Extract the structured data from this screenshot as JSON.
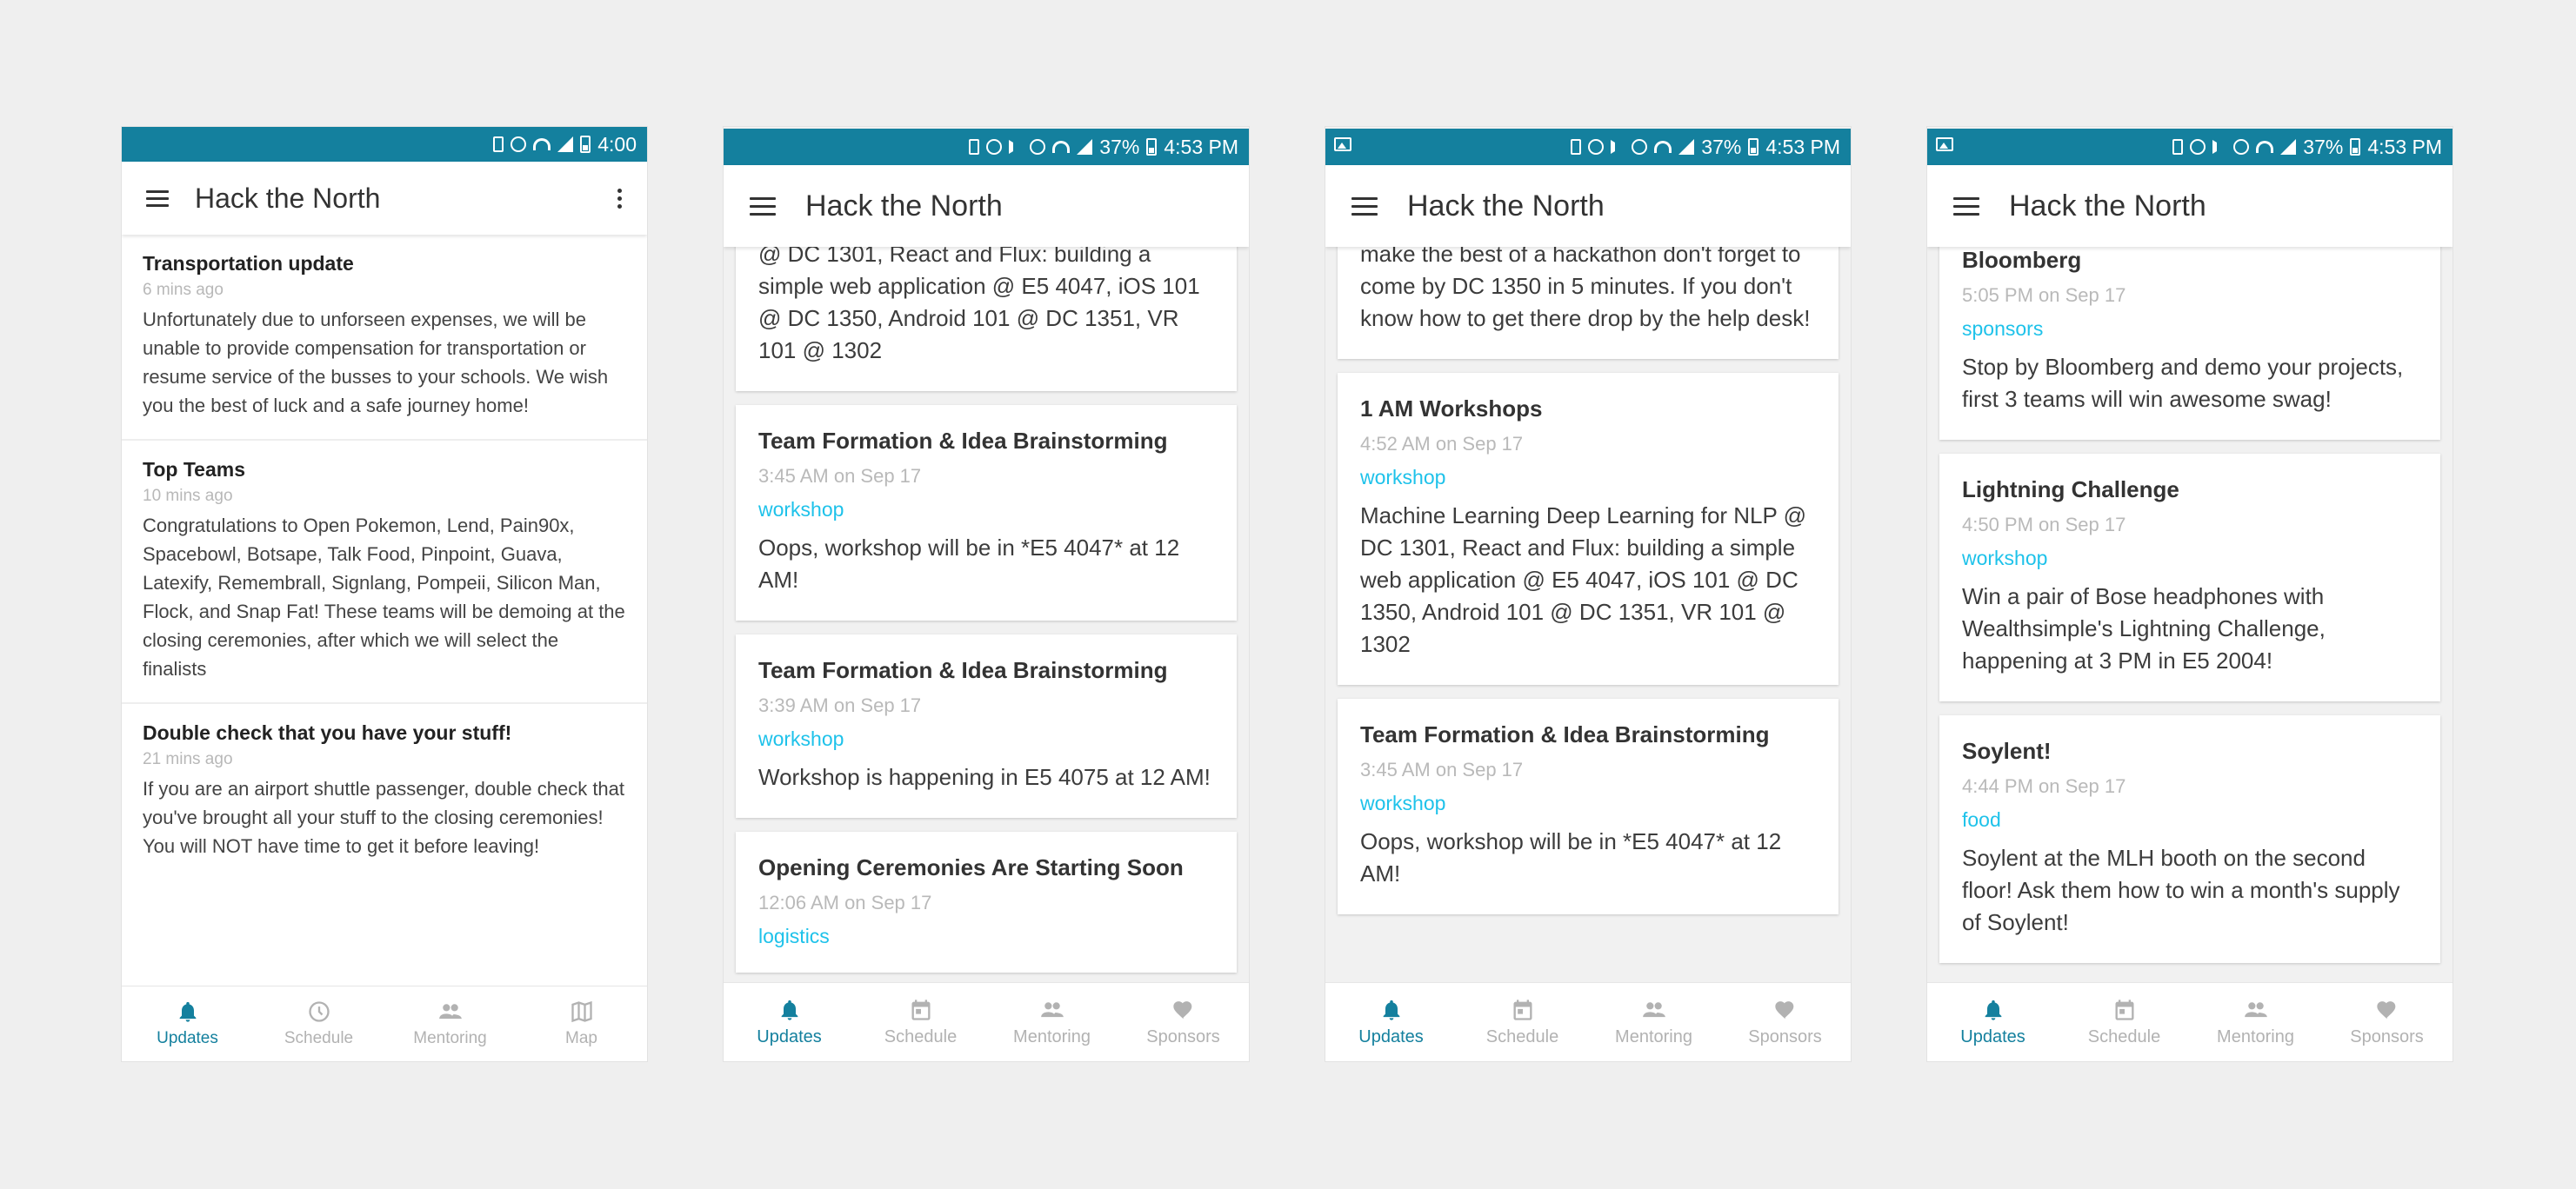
{
  "colors": {
    "statusbar": "#14809e",
    "accent": "#14809e",
    "tag": "#1ec2ea",
    "inactive": "#b2b2b2",
    "background": "#efefef"
  },
  "app_title": "Hack the North",
  "screens": [
    {
      "status": {
        "time": "4:00",
        "battery": "",
        "icons": [
          "vibrate-icon",
          "alarm-icon",
          "wifi-icon",
          "signal-icon",
          "battery-icon"
        ]
      },
      "updates": [
        {
          "title": "Transportation update",
          "time": "6 mins ago",
          "body": "Unfortunately due to unforseen expenses, we will be unable to provide compensation for transportation or resume service of the busses to your schools. We wish you the best of luck and a safe journey home!"
        },
        {
          "title": "Top Teams",
          "time": "10 mins ago",
          "body": "Congratulations to Open Pokemon, Lend, Pain90x, Spacebowl, Botsape, Talk Food, Pinpoint, Guava, Latexify, Remembrall, Signlang, Pompeii, Silicon Man, Flock, and Snap Fat! These teams will be demoing at the closing ceremonies, after which we will select the finalists"
        },
        {
          "title": "Double check that you have your stuff!",
          "time": "21 mins ago",
          "body": "If you are an airport shuttle passenger, double check that you've brought all your stuff to the closing ceremonies! You will NOT have time to get it before leaving!"
        }
      ],
      "nav": [
        {
          "label": "Updates",
          "icon": "bell-icon",
          "active": true
        },
        {
          "label": "Schedule",
          "icon": "clock-icon",
          "active": false
        },
        {
          "label": "Mentoring",
          "icon": "people-icon",
          "active": false
        },
        {
          "label": "Map",
          "icon": "map-icon",
          "active": false
        }
      ]
    },
    {
      "status": {
        "time": "4:53 PM",
        "battery": "37%"
      },
      "cards": [
        {
          "title": "",
          "time": "",
          "tag": "",
          "body": "@ DC 1301, React and Flux: building a simple web application @ E5 4047, iOS 101 @ DC 1350, Android 101 @ DC 1351, VR 101 @ 1302"
        },
        {
          "title": "Team Formation & Idea Brainstorming",
          "time": "3:45 AM on Sep 17",
          "tag": "workshop",
          "body": "Oops, workshop will be in *E5 4047* at 12 AM!"
        },
        {
          "title": "Team Formation & Idea Brainstorming",
          "time": "3:39 AM on Sep 17",
          "tag": "workshop",
          "body": "Workshop is happening in E5 4075 at 12 AM!"
        },
        {
          "title": "Opening Ceremonies Are Starting Soon",
          "time": "12:06 AM on Sep 17",
          "tag": "logistics",
          "body": ""
        }
      ],
      "nav": [
        {
          "label": "Updates",
          "active": true
        },
        {
          "label": "Schedule",
          "active": false
        },
        {
          "label": "Mentoring",
          "active": false
        },
        {
          "label": "Sponsors",
          "active": false
        }
      ]
    },
    {
      "status": {
        "time": "4:53 PM",
        "battery": "37%"
      },
      "cards": [
        {
          "title": "",
          "time": "",
          "tag": "",
          "body": "make the best of a hackathon don't forget to come by DC 1350 in 5 minutes. If you don't know how to get there drop by the help desk!"
        },
        {
          "title": "1 AM Workshops",
          "time": "4:52 AM on Sep 17",
          "tag": "workshop",
          "body": "Machine Learning Deep Learning for NLP @ DC 1301, React and Flux: building a simple web application @ E5 4047, iOS 101 @ DC 1350, Android 101 @ DC 1351, VR 101 @ 1302"
        },
        {
          "title": "Team Formation & Idea Brainstorming",
          "time": "3:45 AM on Sep 17",
          "tag": "workshop",
          "body": "Oops, workshop will be in *E5 4047* at 12 AM!"
        }
      ],
      "nav": [
        {
          "label": "Updates",
          "active": true
        },
        {
          "label": "Schedule",
          "active": false
        },
        {
          "label": "Mentoring",
          "active": false
        },
        {
          "label": "Sponsors",
          "active": false
        }
      ]
    },
    {
      "status": {
        "time": "4:53 PM",
        "battery": "37%"
      },
      "cards": [
        {
          "title": "Bloomberg",
          "time": "5:05 PM on Sep 17",
          "tag": "sponsors",
          "body": "Stop by Bloomberg and demo your projects, first 3 teams will win awesome swag!"
        },
        {
          "title": "Lightning Challenge",
          "time": "4:50 PM on Sep 17",
          "tag": "workshop",
          "body": "Win a pair of Bose headphones with Wealthsimple's Lightning Challenge, happening at 3 PM in E5 2004!"
        },
        {
          "title": "Soylent!",
          "time": "4:44 PM on Sep 17",
          "tag": "food",
          "body": "Soylent at the MLH booth on the second floor! Ask them how to win a month's supply of Soylent!"
        }
      ],
      "nav": [
        {
          "label": "Updates",
          "active": true
        },
        {
          "label": "Schedule",
          "active": false
        },
        {
          "label": "Mentoring",
          "active": false
        },
        {
          "label": "Sponsors",
          "active": false
        }
      ]
    }
  ]
}
